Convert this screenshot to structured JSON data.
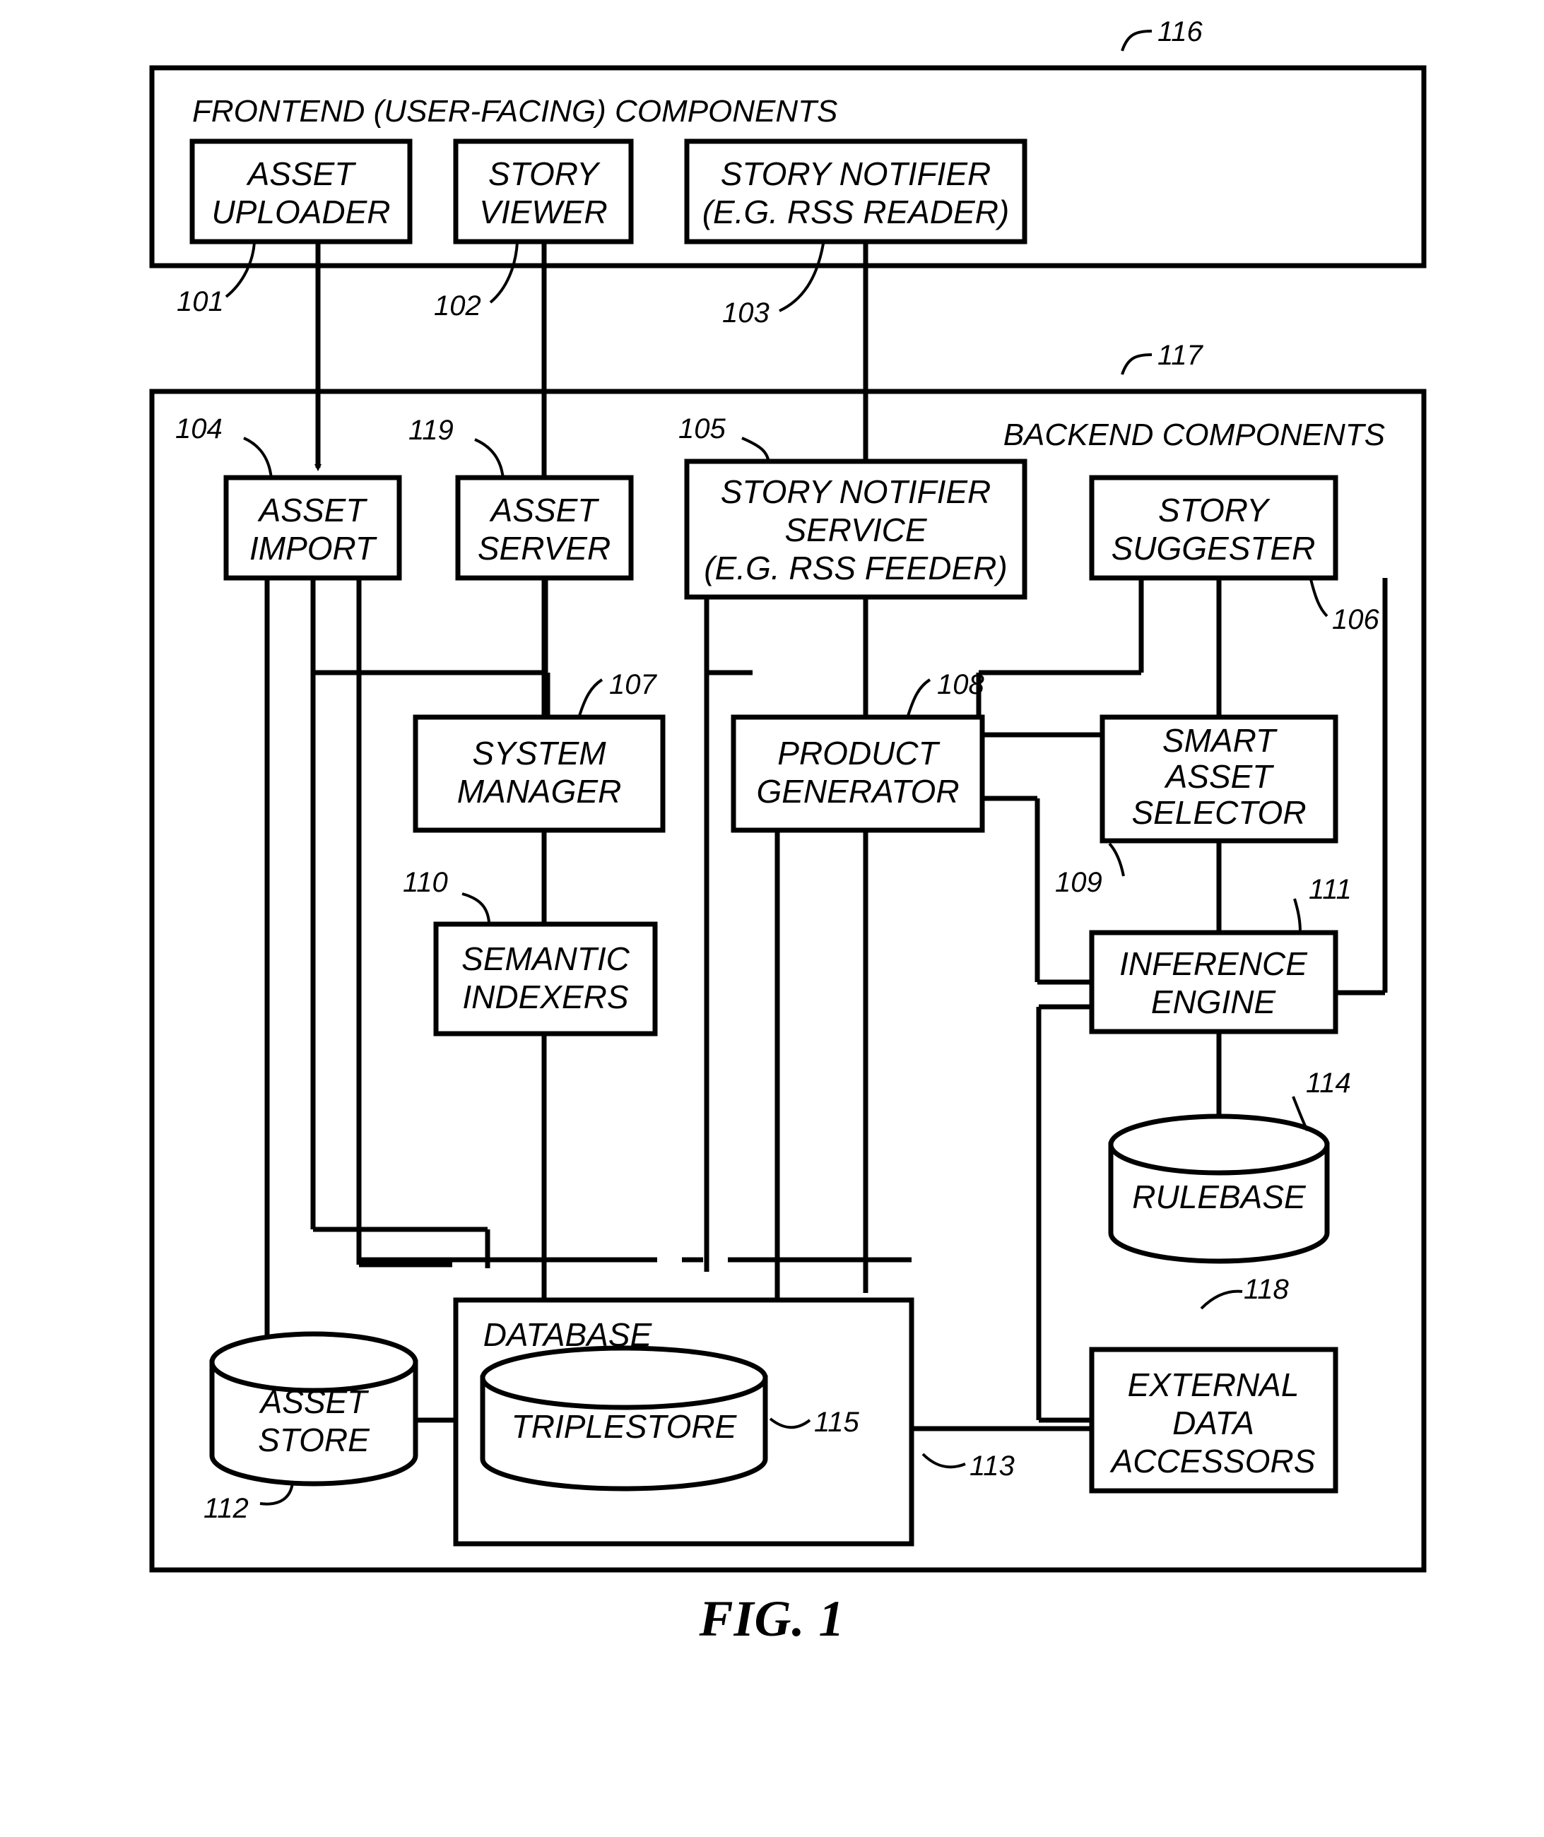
{
  "figure": {
    "caption": "FIG. 1"
  },
  "groups": [
    {
      "id": "frontend",
      "title": "FRONTEND (USER-FACING) COMPONENTS",
      "ref": "116"
    },
    {
      "id": "backend",
      "title": "BACKEND COMPONENTS",
      "ref": "117"
    }
  ],
  "nodes": [
    {
      "id": "asset-uploader",
      "ref": "101",
      "shape": "box",
      "lines": [
        "ASSET",
        "UPLOADER"
      ]
    },
    {
      "id": "story-viewer",
      "ref": "102",
      "shape": "box",
      "lines": [
        "STORY",
        "VIEWER"
      ]
    },
    {
      "id": "story-notifier",
      "ref": "103",
      "shape": "box",
      "lines": [
        "STORY NOTIFIER",
        "(E.G. RSS READER)"
      ]
    },
    {
      "id": "asset-import",
      "ref": "104",
      "shape": "box",
      "lines": [
        "ASSET",
        "IMPORT"
      ]
    },
    {
      "id": "asset-server",
      "ref": "119",
      "shape": "box",
      "lines": [
        "ASSET",
        "SERVER"
      ]
    },
    {
      "id": "story-notifier-service",
      "ref": "105",
      "shape": "box",
      "lines": [
        "STORY NOTIFIER",
        "SERVICE",
        "(E.G. RSS FEEDER)"
      ]
    },
    {
      "id": "story-suggester",
      "ref": "106",
      "shape": "box",
      "lines": [
        "STORY",
        "SUGGESTER"
      ]
    },
    {
      "id": "system-manager",
      "ref": "107",
      "shape": "box",
      "lines": [
        "SYSTEM",
        "MANAGER"
      ]
    },
    {
      "id": "product-generator",
      "ref": "108",
      "shape": "box",
      "lines": [
        "PRODUCT",
        "GENERATOR"
      ]
    },
    {
      "id": "smart-asset-selector",
      "ref": "109",
      "shape": "box",
      "lines": [
        "SMART",
        "ASSET",
        "SELECTOR"
      ]
    },
    {
      "id": "semantic-indexers",
      "ref": "110",
      "shape": "box",
      "lines": [
        "SEMANTIC",
        "INDEXERS"
      ]
    },
    {
      "id": "inference-engine",
      "ref": "111",
      "shape": "box",
      "lines": [
        "INFERENCE",
        "ENGINE"
      ]
    },
    {
      "id": "asset-store",
      "ref": "112",
      "shape": "cylinder",
      "lines": [
        "ASSET",
        "STORE"
      ]
    },
    {
      "id": "database",
      "ref": "113",
      "shape": "box",
      "lines": [
        "DATABASE"
      ]
    },
    {
      "id": "rulebase",
      "ref": "114",
      "shape": "cylinder",
      "lines": [
        "RULEBASE"
      ]
    },
    {
      "id": "triplestore",
      "ref": "115",
      "shape": "cylinder",
      "lines": [
        "TRIPLESTORE"
      ]
    },
    {
      "id": "external-data-accessors",
      "ref": "118",
      "shape": "box",
      "lines": [
        "EXTERNAL",
        "DATA",
        "ACCESSORS"
      ]
    }
  ],
  "ref_labels": {
    "n101": "101",
    "n102": "102",
    "n103": "103",
    "n104": "104",
    "n105": "105",
    "n106": "106",
    "n107": "107",
    "n108": "108",
    "n109": "109",
    "n110": "110",
    "n111": "111",
    "n112": "112",
    "n113": "113",
    "n114": "114",
    "n115": "115",
    "n116": "116",
    "n117": "117",
    "n118": "118",
    "n119": "119"
  },
  "node_labels": {
    "asset_uploader_l1": "ASSET",
    "asset_uploader_l2": "UPLOADER",
    "story_viewer_l1": "STORY",
    "story_viewer_l2": "VIEWER",
    "story_notifier_l1": "STORY NOTIFIER",
    "story_notifier_l2": "(E.G. RSS READER)",
    "asset_import_l1": "ASSET",
    "asset_import_l2": "IMPORT",
    "asset_server_l1": "ASSET",
    "asset_server_l2": "SERVER",
    "sns_l1": "STORY NOTIFIER",
    "sns_l2": "SERVICE",
    "sns_l3": "(E.G. RSS FEEDER)",
    "story_suggester_l1": "STORY",
    "story_suggester_l2": "SUGGESTER",
    "system_manager_l1": "SYSTEM",
    "system_manager_l2": "MANAGER",
    "product_generator_l1": "PRODUCT",
    "product_generator_l2": "GENERATOR",
    "smart_asset_selector_l1": "SMART",
    "smart_asset_selector_l2": "ASSET",
    "smart_asset_selector_l3": "SELECTOR",
    "semantic_indexers_l1": "SEMANTIC",
    "semantic_indexers_l2": "INDEXERS",
    "inference_engine_l1": "INFERENCE",
    "inference_engine_l2": "ENGINE",
    "asset_store_l1": "ASSET",
    "asset_store_l2": "STORE",
    "database_l1": "DATABASE",
    "rulebase_l1": "RULEBASE",
    "triplestore_l1": "TRIPLESTORE",
    "eda_l1": "EXTERNAL",
    "eda_l2": "DATA",
    "eda_l3": "ACCESSORS",
    "frontend_title": "FRONTEND (USER-FACING) COMPONENTS",
    "backend_title": "BACKEND COMPONENTS"
  },
  "colors": {
    "stroke": "#000000",
    "background": "#ffffff"
  }
}
